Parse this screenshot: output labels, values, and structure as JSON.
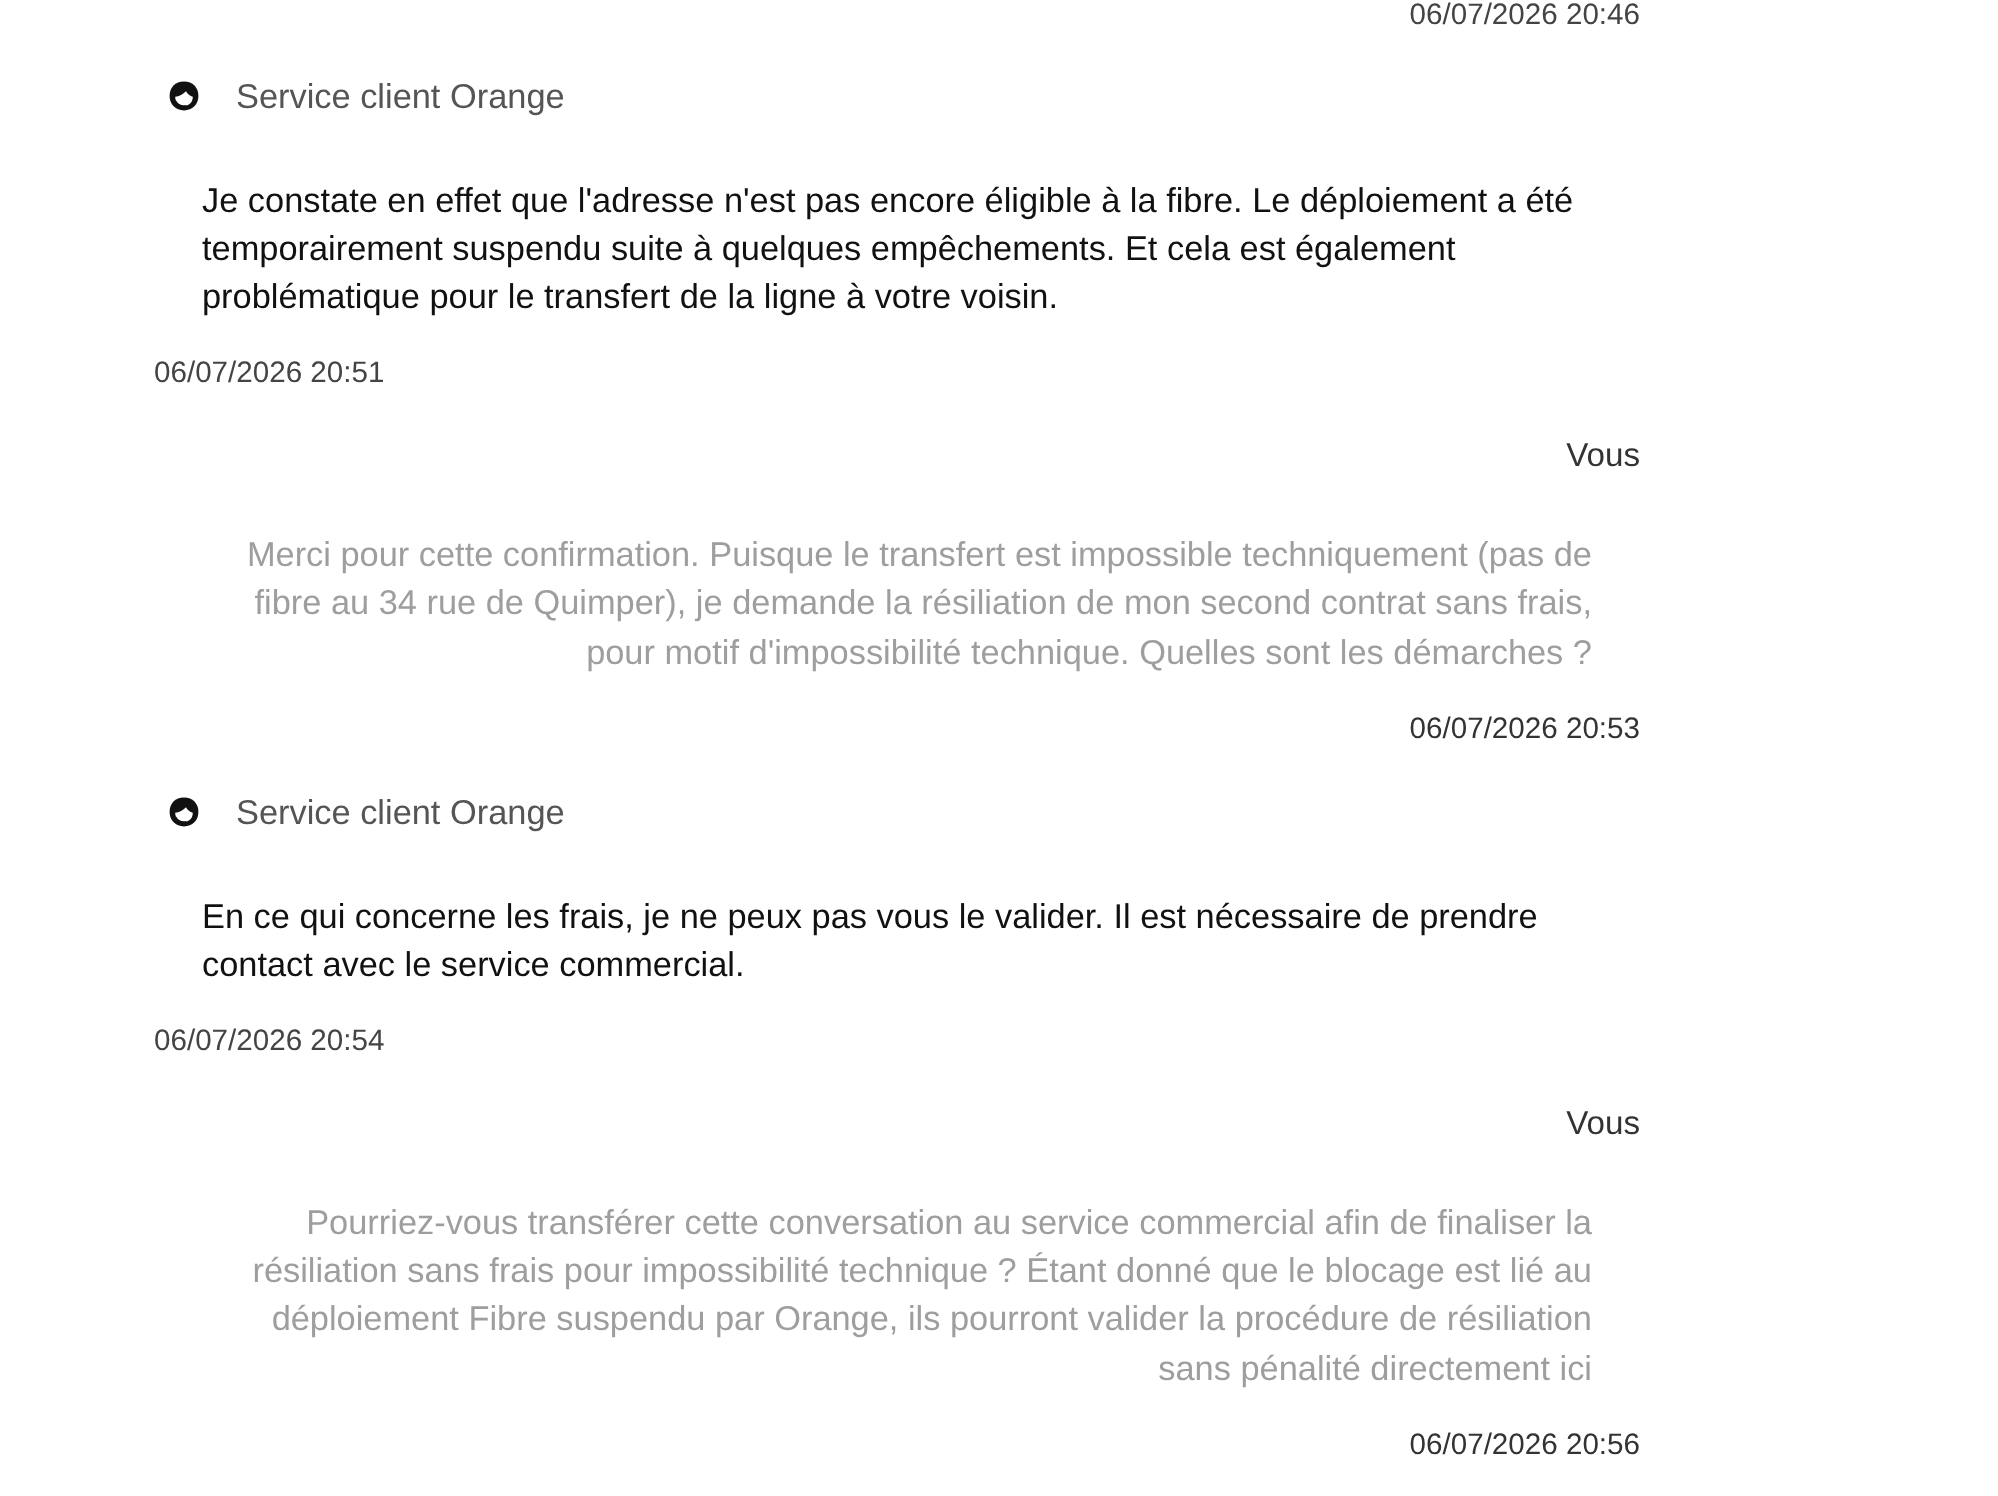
{
  "previous_timestamp": "06/07/2026 20:46",
  "messages": [
    {
      "kind": "agent",
      "sender": "Service client Orange",
      "text": "Je constate en effet que l'adresse n'est pas encore éligible à la fibre. Le déploiement a été temporairement suspendu suite à quelques empêchements. Et cela est également problématique pour le transfert de la ligne à votre voisin.",
      "timestamp": "06/07/2026 20:51"
    },
    {
      "kind": "user",
      "sender": "Vous",
      "text": "Merci pour cette confirmation. Puisque le transfert est impossible techniquement (pas de fibre au 34 rue de Quimper), je demande la résiliation de mon second contrat sans frais, pour motif d'impossibilité technique. Quelles sont les démarches ?",
      "timestamp": "06/07/2026 20:53"
    },
    {
      "kind": "agent",
      "sender": "Service client Orange",
      "text": "En ce qui concerne les frais, je ne peux pas vous le valider. Il est nécessaire de prendre contact avec le service commercial.",
      "timestamp": "06/07/2026 20:54"
    },
    {
      "kind": "user",
      "sender": "Vous",
      "text": "Pourriez-vous transférer cette conversation au service commercial afin de finaliser la résiliation sans frais pour impossibilité technique ? Étant donné que le blocage est lié au déploiement Fibre suspendu par Orange, ils pourront valider la procédure de résiliation sans pénalité directement ici",
      "timestamp": "06/07/2026 20:56"
    }
  ]
}
